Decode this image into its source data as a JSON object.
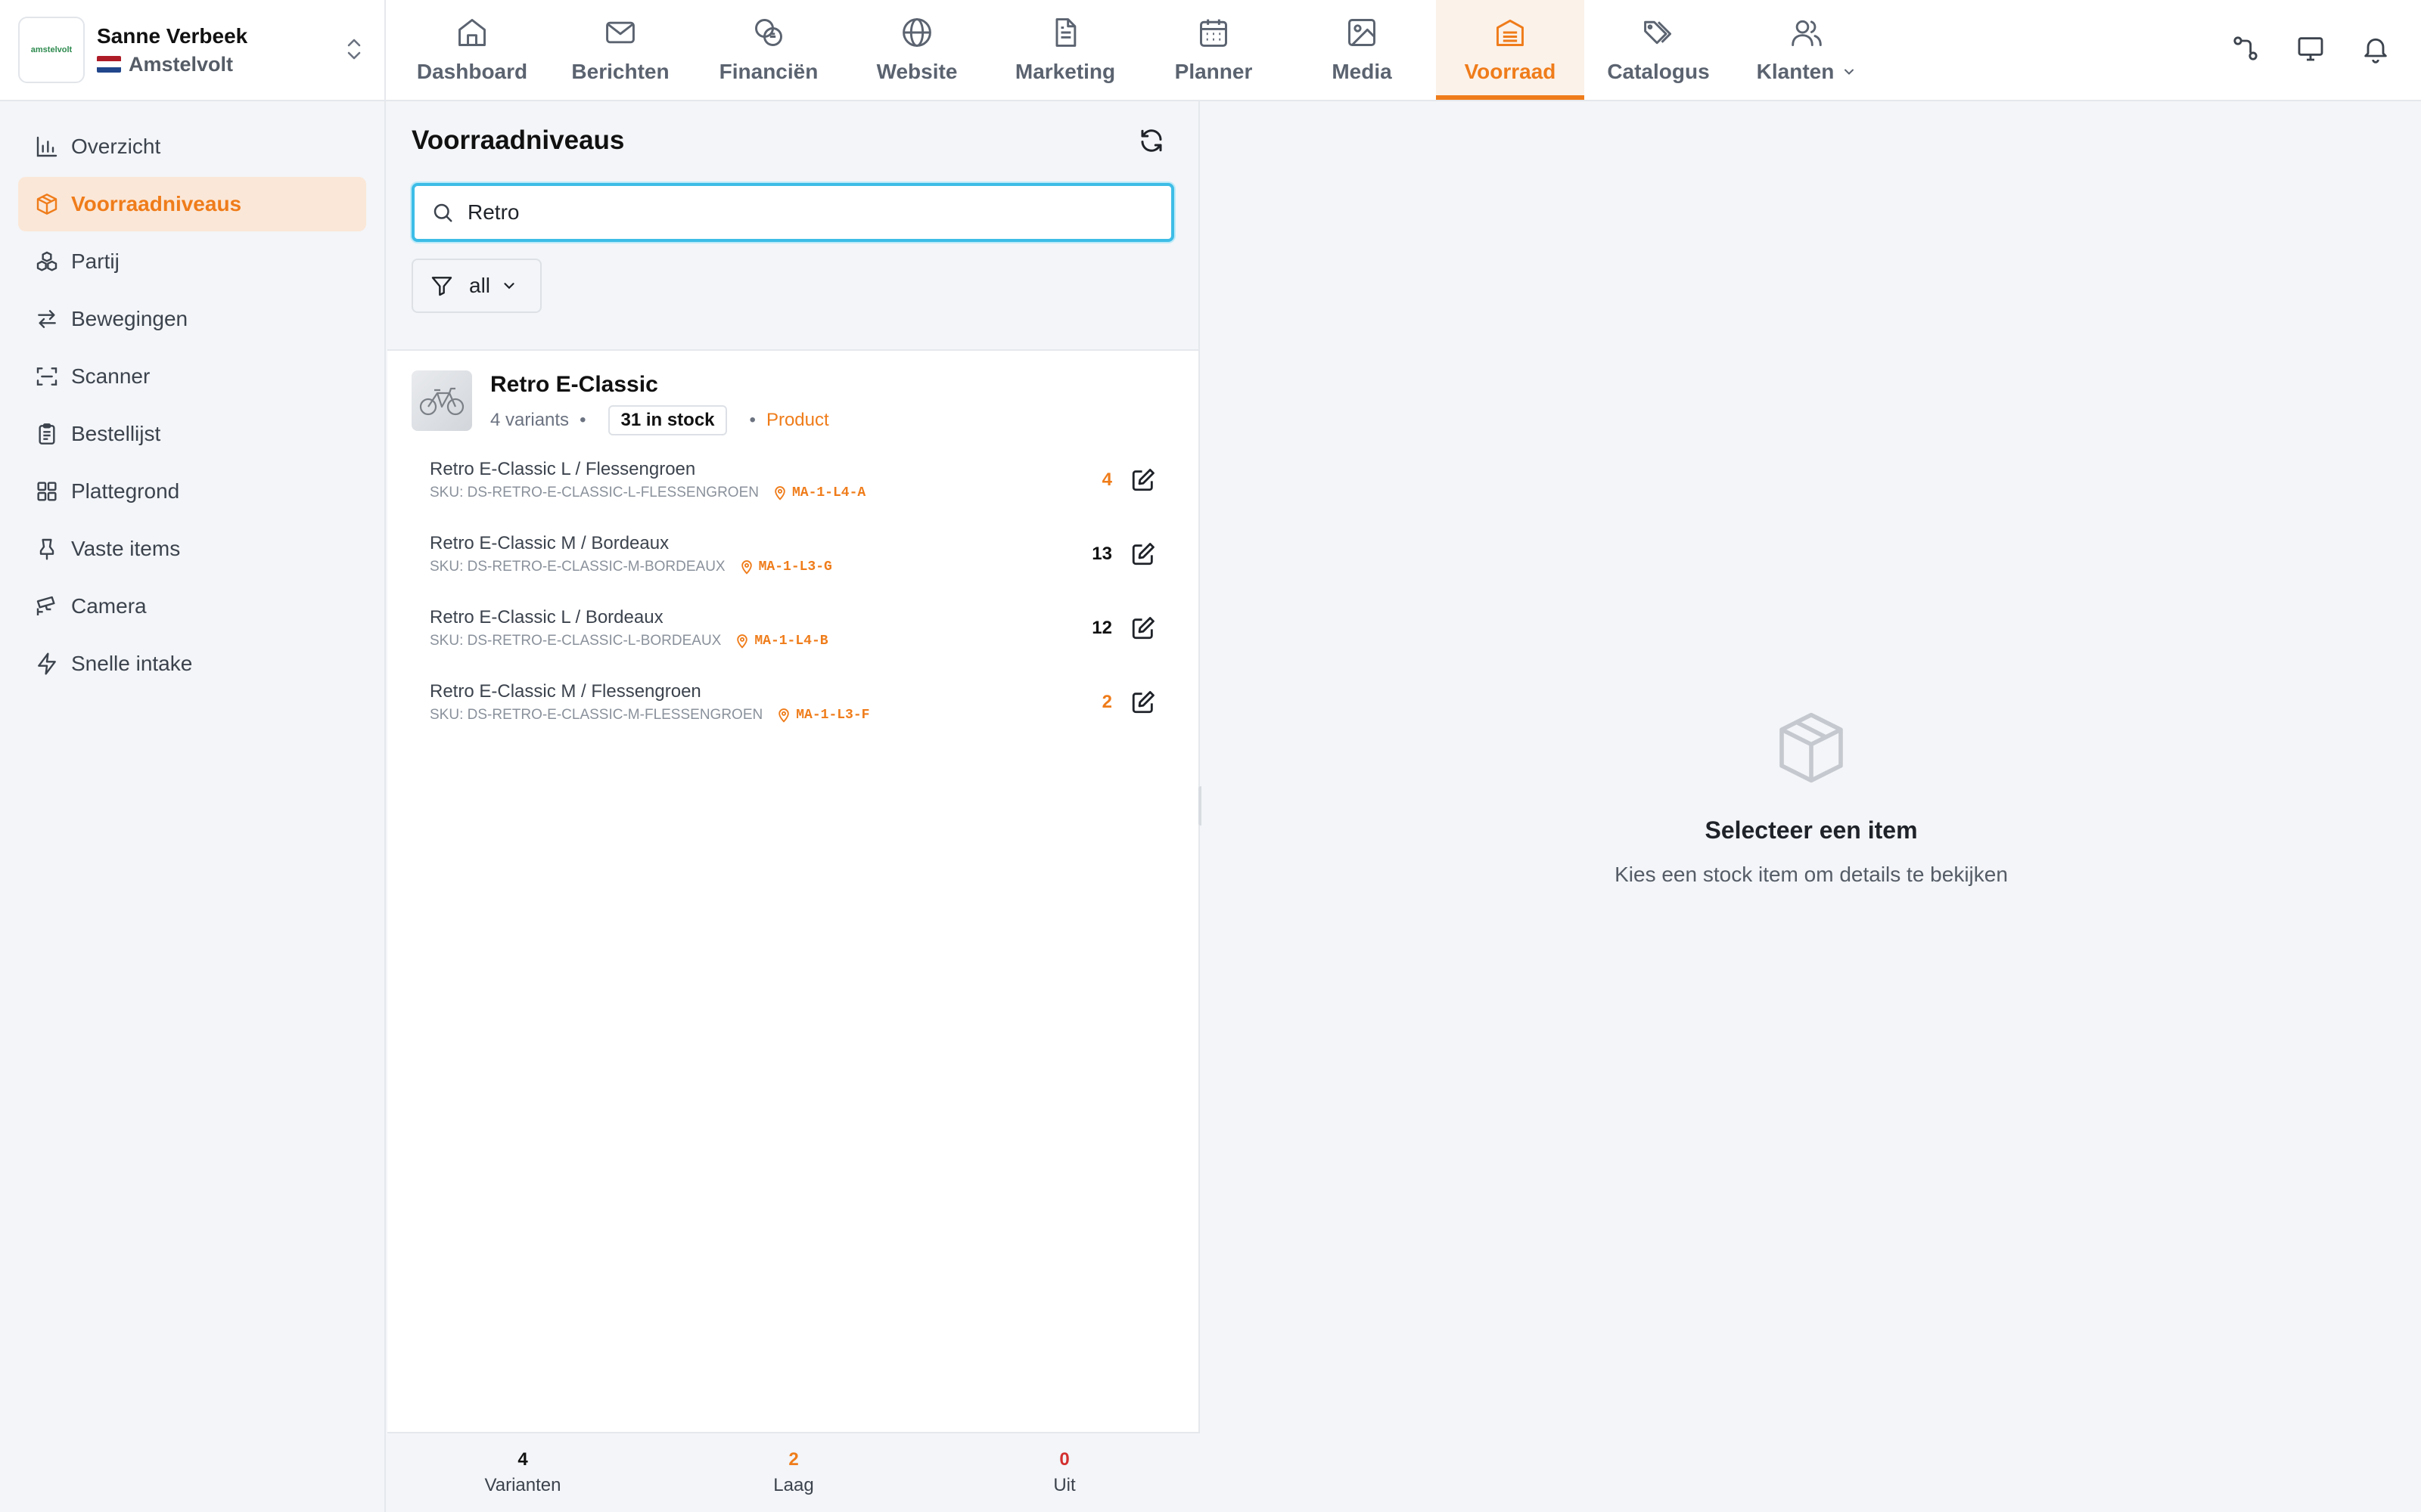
{
  "org": {
    "name": "Sanne Verbeek",
    "location": "Amstelvolt",
    "logo_text": "amstelvolt"
  },
  "nav": [
    {
      "label": "Dashboard",
      "icon": "home-icon"
    },
    {
      "label": "Berichten",
      "icon": "mail-icon"
    },
    {
      "label": "Financiën",
      "icon": "coins-icon"
    },
    {
      "label": "Website",
      "icon": "globe-icon"
    },
    {
      "label": "Marketing",
      "icon": "document-icon"
    },
    {
      "label": "Planner",
      "icon": "calendar-icon"
    },
    {
      "label": "Media",
      "icon": "image-icon"
    },
    {
      "label": "Voorraad",
      "icon": "warehouse-icon",
      "active": true
    },
    {
      "label": "Catalogus",
      "icon": "tags-icon"
    },
    {
      "label": "Klanten",
      "icon": "users-icon"
    }
  ],
  "sidebar": {
    "items": [
      {
        "label": "Overzicht",
        "icon": "bar-chart-icon"
      },
      {
        "label": "Voorraadniveaus",
        "icon": "box-icon",
        "active": true
      },
      {
        "label": "Partij",
        "icon": "boxes-icon"
      },
      {
        "label": "Bewegingen",
        "icon": "arrows-icon"
      },
      {
        "label": "Scanner",
        "icon": "scan-icon"
      },
      {
        "label": "Bestellijst",
        "icon": "clipboard-icon"
      },
      {
        "label": "Plattegrond",
        "icon": "grid-icon"
      },
      {
        "label": "Vaste items",
        "icon": "pin-icon"
      },
      {
        "label": "Camera",
        "icon": "cctv-icon"
      },
      {
        "label": "Snelle intake",
        "icon": "zap-icon"
      }
    ]
  },
  "panel": {
    "title": "Voorraadniveaus",
    "search_value": "Retro",
    "filter_value": "all"
  },
  "product": {
    "name": "Retro E-Classic",
    "variants_text": "4 variants",
    "stock_text": "31 in stock",
    "type": "Product"
  },
  "variants": [
    {
      "name": "Retro E-Classic L / Flessengroen",
      "sku": "SKU: DS-RETRO-E-CLASSIC-L-FLESSENGROEN",
      "location": "MA-1-L4-A",
      "qty": "4",
      "low": true
    },
    {
      "name": "Retro E-Classic M / Bordeaux",
      "sku": "SKU: DS-RETRO-E-CLASSIC-M-BORDEAUX",
      "location": "MA-1-L3-G",
      "qty": "13",
      "low": false
    },
    {
      "name": "Retro E-Classic L / Bordeaux",
      "sku": "SKU: DS-RETRO-E-CLASSIC-L-BORDEAUX",
      "location": "MA-1-L4-B",
      "qty": "12",
      "low": false
    },
    {
      "name": "Retro E-Classic M / Flessengroen",
      "sku": "SKU: DS-RETRO-E-CLASSIC-M-FLESSENGROEN",
      "location": "MA-1-L3-F",
      "qty": "2",
      "low": true
    }
  ],
  "stats": {
    "variants": {
      "value": "4",
      "label": "Varianten"
    },
    "low": {
      "value": "2",
      "label": "Laag"
    },
    "out": {
      "value": "0",
      "label": "Uit"
    }
  },
  "detail": {
    "empty_title": "Selecteer een item",
    "empty_sub": "Kies een stock item om details te bekijken"
  },
  "colors": {
    "accent": "#ef7c1a",
    "focus": "#3dbde7",
    "out": "#d32f2f"
  }
}
